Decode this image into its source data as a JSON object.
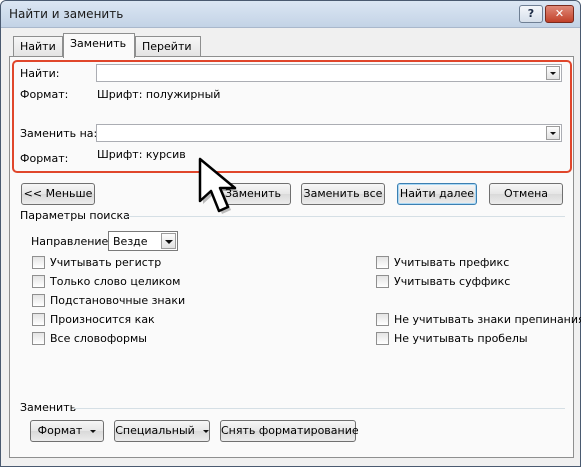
{
  "window": {
    "title": "Найти и заменить",
    "help_glyph": "?",
    "close_glyph": "✕"
  },
  "tabs": [
    {
      "label": "Найти"
    },
    {
      "label": "Заменить"
    },
    {
      "label": "Перейти"
    }
  ],
  "find": {
    "label": "Найти:",
    "value": "",
    "format_label": "Формат:",
    "format_value": "Шрифт: полужирный"
  },
  "replace": {
    "label": "Заменить на:",
    "value": "",
    "format_label": "Формат:",
    "format_value": "Шрифт: курсив"
  },
  "buttons": {
    "less": "<< Меньше",
    "replace": "Заменить",
    "replace_all": "Заменить все",
    "find_next": "Найти далее",
    "cancel": "Отмена"
  },
  "search_options": {
    "group_label": "Параметры поиска",
    "direction_label": "Направление:",
    "direction_value": "Везде",
    "left": [
      {
        "label": "Учитывать регистр",
        "checked": false
      },
      {
        "label": "Только слово целиком",
        "checked": false
      },
      {
        "label": "Подстановочные знаки",
        "checked": false
      },
      {
        "label": "Произносится как",
        "checked": false
      },
      {
        "label": "Все словоформы",
        "checked": false
      }
    ],
    "right": [
      {
        "label": "Учитывать префикс",
        "checked": false
      },
      {
        "label": "Учитывать суффикс",
        "checked": false
      },
      {
        "label": "Не учитывать знаки препинания",
        "checked": false
      },
      {
        "label": "Не учитывать пробелы",
        "checked": false
      }
    ]
  },
  "replace_group": {
    "group_label": "Заменить",
    "format_button": "Формат",
    "special_button": "Специальный",
    "no_formatting_button": "Снять форматирование"
  },
  "colors": {
    "highlight": "#e0462b",
    "default_button_border": "#3c7fb1"
  },
  "icons": {
    "cursor": "mouse-pointer-icon"
  }
}
